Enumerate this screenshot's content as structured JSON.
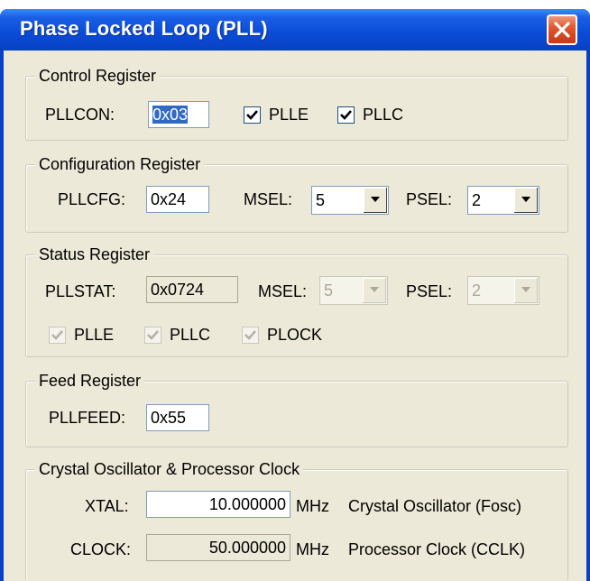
{
  "window": {
    "title": "Phase Locked Loop (PLL)"
  },
  "control": {
    "legend": "Control Register",
    "pllcon_label": "PLLCON:",
    "pllcon_value": "0x03",
    "plle_label": "PLLE",
    "plle_checked": true,
    "pllc_label": "PLLC",
    "pllc_checked": true
  },
  "configuration": {
    "legend": "Configuration Register",
    "pllcfg_label": "PLLCFG:",
    "pllcfg_value": "0x24",
    "msel_label": "MSEL:",
    "msel_value": "5",
    "psel_label": "PSEL:",
    "psel_value": "2"
  },
  "status": {
    "legend": "Status Register",
    "pllstat_label": "PLLSTAT:",
    "pllstat_value": "0x0724",
    "msel_label": "MSEL:",
    "msel_value": "5",
    "psel_label": "PSEL:",
    "psel_value": "2",
    "plle_label": "PLLE",
    "pllc_label": "PLLC",
    "plock_label": "PLOCK",
    "plle_checked": true,
    "pllc_checked": true,
    "plock_checked": true
  },
  "feed": {
    "legend": "Feed Register",
    "pllfeed_label": "PLLFEED:",
    "pllfeed_value": "0x55"
  },
  "clock": {
    "legend": "Crystal Oscillator & Processor Clock",
    "xtal_label": "XTAL:",
    "xtal_value": "10.000000",
    "xtal_unit": "MHz",
    "xtal_desc": "Crystal Oscillator (Fosc)",
    "clock_label": "CLOCK:",
    "clock_value": "50.000000",
    "clock_unit": "MHz",
    "clock_desc": "Processor Clock (CCLK)"
  },
  "colors": {
    "titlebar": "#0a4bd6",
    "client_bg": "#ece9d8",
    "selection": "#316ac5",
    "close_button": "#e0592f"
  }
}
